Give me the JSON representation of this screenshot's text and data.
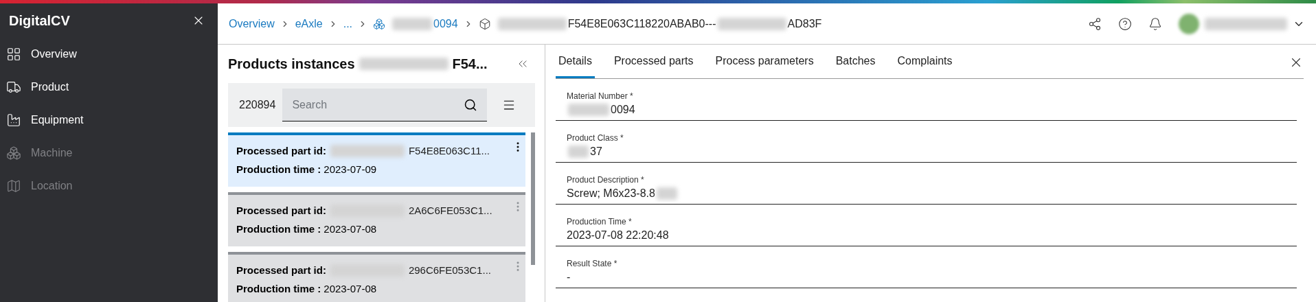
{
  "sidebar": {
    "title": "DigitalCV",
    "items": [
      {
        "label": "Overview",
        "disabled": false
      },
      {
        "label": "Product",
        "disabled": false
      },
      {
        "label": "Equipment",
        "disabled": false
      },
      {
        "label": "Machine",
        "disabled": true
      },
      {
        "label": "Location",
        "disabled": true
      }
    ]
  },
  "breadcrumb": [
    {
      "kind": "link",
      "segments": [
        {
          "kind": "text",
          "text": "Overview"
        }
      ]
    },
    {
      "kind": "link",
      "segments": [
        {
          "kind": "text",
          "text": "eAxle"
        }
      ]
    },
    {
      "kind": "link",
      "segments": [
        {
          "kind": "text",
          "text": "..."
        }
      ]
    },
    {
      "kind": "material",
      "segments": [
        {
          "kind": "redacted"
        },
        {
          "kind": "text",
          "text": "0094"
        }
      ]
    },
    {
      "kind": "current",
      "segments": [
        {
          "kind": "redacted"
        },
        {
          "kind": "text",
          "text": "F54E8E063C118220ABAB0---"
        },
        {
          "kind": "redacted"
        },
        {
          "kind": "text",
          "text": "AD83F"
        }
      ]
    }
  ],
  "list_panel": {
    "title_segments": [
      {
        "kind": "text",
        "text": "Products instances"
      },
      {
        "kind": "redacted"
      },
      {
        "kind": "text",
        "text": "F54..."
      }
    ],
    "count": "220894",
    "search": {
      "placeholder": "Search"
    },
    "cards": [
      {
        "id_label": "Processed part id:",
        "id_value": "F54E8E063C11...",
        "time_label": "Production time :",
        "time_value": "2023-07-09",
        "selected": true
      },
      {
        "id_label": "Processed part id:",
        "id_value": "2A6C6FE053C1...",
        "time_label": "Production time :",
        "time_value": "2023-07-08",
        "selected": false
      },
      {
        "id_label": "Processed part id:",
        "id_value": "296C6FE053C1...",
        "time_label": "Production time :",
        "time_value": "2023-07-08",
        "selected": false
      }
    ]
  },
  "details": {
    "tabs": [
      {
        "label": "Details",
        "selected": true
      },
      {
        "label": "Processed parts",
        "selected": false
      },
      {
        "label": "Process parameters",
        "selected": false
      },
      {
        "label": "Batches",
        "selected": false
      },
      {
        "label": "Complaints",
        "selected": false
      }
    ],
    "fields": [
      {
        "label": "Material Number *",
        "segments": [
          {
            "kind": "redacted"
          },
          {
            "kind": "text",
            "text": "0094"
          }
        ]
      },
      {
        "label": "Product Class *",
        "segments": [
          {
            "kind": "redacted"
          },
          {
            "kind": "text",
            "text": "37"
          }
        ]
      },
      {
        "label": "Product Description *",
        "segments": [
          {
            "kind": "text",
            "text": "Screw; M6x23-8.8"
          },
          {
            "kind": "redacted"
          }
        ]
      },
      {
        "label": "Production Time *",
        "segments": [
          {
            "kind": "text",
            "text": "2023-07-08 22:20:48"
          }
        ]
      },
      {
        "label": "Result State *",
        "segments": [
          {
            "kind": "text",
            "text": "-"
          }
        ]
      }
    ]
  }
}
